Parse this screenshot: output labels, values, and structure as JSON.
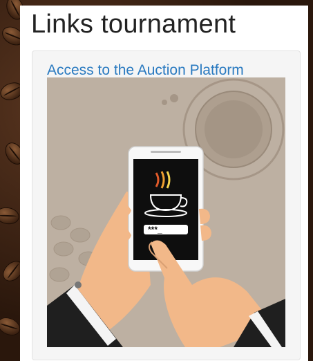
{
  "page": {
    "heading": "Links tournament"
  },
  "card": {
    "link_text": "Access to the Auction Platform",
    "illustration": {
      "subject": "hands holding smartphone with coffee cup logo and password field",
      "password_mask": "***_",
      "icon": "coffee-cup-icon"
    }
  },
  "colors": {
    "link": "#2a7ac0",
    "illustration_bg": "#bdb0a2",
    "skin": "#f2b889",
    "sleeve": "#1f1f1f"
  }
}
